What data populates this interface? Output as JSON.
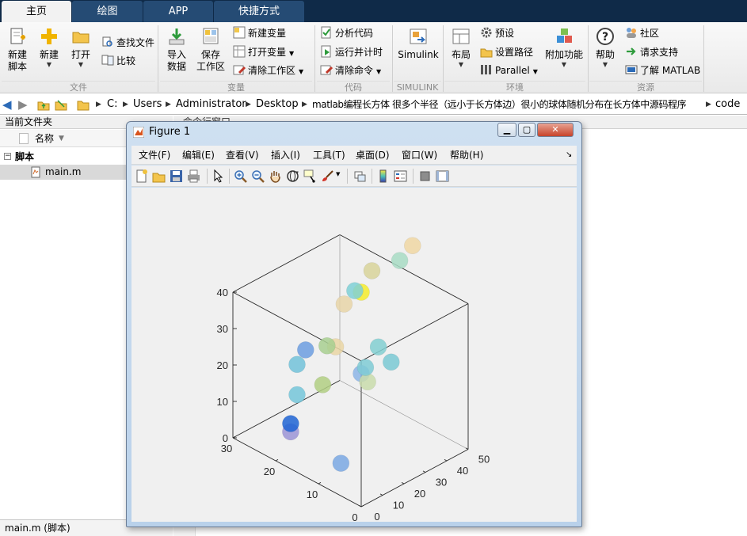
{
  "tabs": [
    {
      "label": "主页",
      "active": true
    },
    {
      "label": "绘图",
      "active": false
    },
    {
      "label": "APP",
      "active": false
    },
    {
      "label": "快捷方式",
      "active": false
    }
  ],
  "ribbon": {
    "file": {
      "group_label": "文件",
      "new_script": [
        "新建",
        "脚本"
      ],
      "new": "新建",
      "open": "打开",
      "find_files": "查找文件",
      "compare": "比较"
    },
    "variable": {
      "group_label": "变量",
      "import": [
        "导入",
        "数据"
      ],
      "save_workspace": [
        "保存",
        "工作区"
      ],
      "new_variable": "新建变量",
      "open_variable": "打开变量",
      "clear_workspace": "清除工作区"
    },
    "code": {
      "group_label": "代码",
      "analyze": "分析代码",
      "run_and_time": "运行并计时",
      "clear_commands": "清除命令"
    },
    "simulink": {
      "group_label": "SIMULINK",
      "button": "Simulink"
    },
    "environment": {
      "group_label": "环境",
      "layout": "布局",
      "preferences": "预设",
      "set_path": "设置路径",
      "parallel": "Parallel",
      "addons": "附加功能"
    },
    "resources": {
      "group_label": "资源",
      "help": "帮助",
      "community": "社区",
      "request_support": "请求支持",
      "learn_matlab": "了解 MATLAB"
    }
  },
  "address": {
    "crumbs": [
      "C:",
      "Users",
      "Administrator",
      "Desktop",
      "matlab编程长方体 很多个半径（远小于长方体边）很小的球体随机分布在长方体中源码程序",
      "code"
    ]
  },
  "file_panel": {
    "title": "当前文件夹",
    "column": "名称",
    "group": "脚本",
    "files": [
      "main.m"
    ],
    "status": "main.m  (脚本)"
  },
  "command_window": {
    "title": "命令行窗口"
  },
  "figure": {
    "title": "Figure 1",
    "menus": [
      "文件(F)",
      "编辑(E)",
      "查看(V)",
      "插入(I)",
      "工具(T)",
      "桌面(D)",
      "窗口(W)",
      "帮助(H)"
    ],
    "toolbar_icons": [
      "new-figure-icon",
      "open-icon",
      "save-icon",
      "print-icon",
      "pointer-icon",
      "zoom-in-icon",
      "zoom-out-icon",
      "pan-icon",
      "rotate-3d-icon",
      "data-cursor-icon",
      "brush-icon",
      "link-plot-icon",
      "colorbar-icon",
      "legend-icon",
      "hide-plot-tools-icon",
      "show-plot-tools-icon"
    ]
  },
  "chart_data": {
    "type": "scatter3d",
    "title": "",
    "xlabel": "",
    "ylabel": "",
    "zlabel": "",
    "xlim": [
      0,
      30
    ],
    "ylim": [
      0,
      50
    ],
    "zlim": [
      0,
      40
    ],
    "xticks": [
      0,
      10,
      20,
      30
    ],
    "yticks": [
      0,
      10,
      20,
      30,
      40,
      50
    ],
    "zticks": [
      0,
      10,
      20,
      30,
      40
    ],
    "marker": "sphere",
    "points": [
      {
        "x": 5.5,
        "y": 1.5,
        "z": 8,
        "color": "#7aa8e3"
      },
      {
        "x": 19,
        "y": 5,
        "z": 7,
        "color": "#9b94d6"
      },
      {
        "x": 20,
        "y": 7,
        "z": 8,
        "color": "#1f64d4"
      },
      {
        "x": 20,
        "y": 10,
        "z": 15,
        "color": "#74c5d9"
      },
      {
        "x": 16,
        "y": 24,
        "z": 38,
        "color": "#e8d5a8"
      },
      {
        "x": 15,
        "y": 30,
        "z": 40,
        "color": "#f4ec2c"
      },
      {
        "x": 6,
        "y": 12,
        "z": 29,
        "color": "#8cb5e6"
      },
      {
        "x": 5,
        "y": 24,
        "z": 29,
        "color": "#7ac9d3"
      },
      {
        "x": 9,
        "y": 26,
        "z": 30,
        "color": "#83cfd1"
      },
      {
        "x": 10,
        "y": 22,
        "z": 25,
        "color": "#7fcbd5"
      },
      {
        "x": 9,
        "y": 21,
        "z": 22,
        "color": "#c9dcab"
      },
      {
        "x": 18,
        "y": 24,
        "z": 25,
        "color": "#ead6a5"
      },
      {
        "x": 20,
        "y": 24,
        "z": 24,
        "color": "#a8cf90"
      },
      {
        "x": 16,
        "y": 14,
        "z": 19,
        "color": "#b2cf83"
      },
      {
        "x": 24,
        "y": 22,
        "z": 21,
        "color": "#6c9ee0"
      },
      {
        "x": 25,
        "y": 20,
        "z": 17,
        "color": "#72c2d9"
      },
      {
        "x": 24,
        "y": 45,
        "z": 30,
        "color": "#7fd0d6"
      },
      {
        "x": 20,
        "y": 45,
        "z": 38,
        "color": "#d8d39a"
      },
      {
        "x": 15,
        "y": 48,
        "z": 43,
        "color": "#a8dcc4"
      },
      {
        "x": 12,
        "y": 48,
        "z": 49,
        "color": "#f0d7a3"
      }
    ]
  }
}
